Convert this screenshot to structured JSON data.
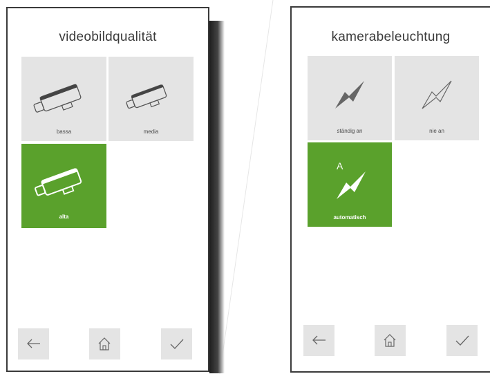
{
  "left_screen": {
    "title": "videobildqualität",
    "options": [
      {
        "label": "bassa",
        "icon": "camera-icon",
        "selected": false
      },
      {
        "label": "media",
        "icon": "camera-icon",
        "selected": false
      },
      {
        "label": "alta",
        "icon": "camera-icon",
        "selected": true
      }
    ],
    "nav": {
      "back_icon": "arrow-left-icon",
      "home_icon": "home-icon",
      "confirm_icon": "checkmark-icon"
    }
  },
  "right_screen": {
    "title": "kamerabeleuchtung",
    "options": [
      {
        "label": "ständig an",
        "icon": "lightning-icon",
        "selected": false
      },
      {
        "label": "nie an",
        "icon": "lightning-outline-icon",
        "selected": false
      },
      {
        "label": "automatisch",
        "icon": "lightning-auto-icon",
        "badge": "A",
        "selected": true
      }
    ],
    "nav": {
      "back_icon": "arrow-left-icon",
      "home_icon": "home-icon",
      "confirm_icon": "checkmark-icon"
    }
  },
  "colors": {
    "selected": "#5aa12c",
    "tile": "#e4e4e4",
    "frame": "#3a3a3a"
  }
}
